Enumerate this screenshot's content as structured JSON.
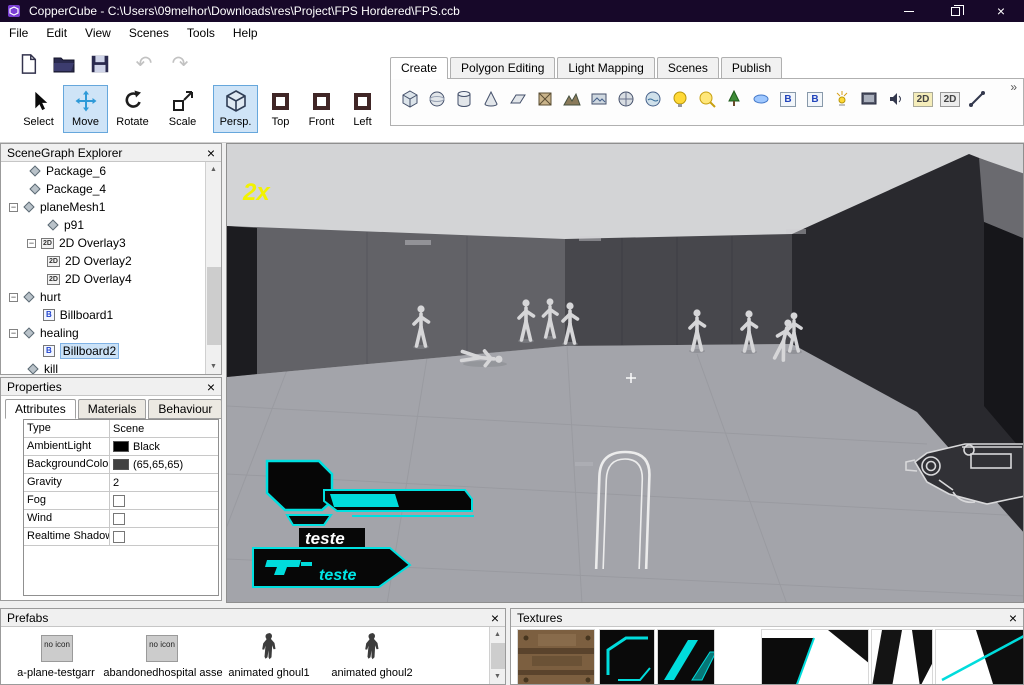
{
  "window": {
    "title": "CopperCube - C:\\Users\\09melhor\\Downloads\\res\\Project\\FPS Hordered\\FPS.ccb"
  },
  "menu": {
    "items": [
      "File",
      "Edit",
      "View",
      "Scenes",
      "Tools",
      "Help"
    ]
  },
  "ribbon": {
    "tabs": [
      "Create",
      "Polygon Editing",
      "Light Mapping",
      "Scenes",
      "Publish"
    ],
    "active_tab": "Create",
    "overflow": "»"
  },
  "tools": {
    "labels": [
      "Select",
      "Move",
      "Rotate",
      "Scale",
      "Persp.",
      "Top",
      "Front",
      "Left"
    ],
    "selected": [
      "Move",
      "Persp."
    ]
  },
  "icons": {
    "close": "×",
    "collapse": "−",
    "undo": "↶",
    "redo": "↷",
    "badge_b": "B",
    "badge_2d": "2D",
    "scroll_up": "▲",
    "scroll_down": "▼"
  },
  "scenegraph": {
    "title": "SceneGraph Explorer",
    "items": [
      "Package_6",
      "Package_4",
      "planeMesh1",
      "p91",
      "2D Overlay3",
      "2D Overlay2",
      "2D Overlay4",
      "hurt",
      "Billboard1",
      "healing",
      "Billboard2",
      "kill"
    ],
    "selected_item": "Billboard2"
  },
  "properties": {
    "title": "Properties",
    "tabs": [
      "Attributes",
      "Materials",
      "Behaviour"
    ],
    "active_tab": "Attributes",
    "rows": [
      {
        "name": "Type",
        "value": "Scene"
      },
      {
        "name": "AmbientLight",
        "value": "Black",
        "swatch": "#000000"
      },
      {
        "name": "BackgroundColor",
        "value": "(65,65,65)",
        "swatch": "#414141"
      },
      {
        "name": "Gravity",
        "value": "2"
      },
      {
        "name": "Fog",
        "value": ""
      },
      {
        "name": "Wind",
        "value": ""
      },
      {
        "name": "Realtime Shadow",
        "value": ""
      }
    ]
  },
  "viewport": {
    "speed_indicator": "2x",
    "hud_label_1": "teste",
    "hud_label_2": "teste"
  },
  "prefabs": {
    "title": "Prefabs",
    "no_icon_label": "no icon",
    "items": [
      "a-plane-testgarr",
      "abandonedhospital asse",
      "animated ghoul1",
      "animated ghoul2"
    ]
  },
  "textures": {
    "title": "Textures"
  },
  "colors": {
    "accent_cyan": "#00e0e0",
    "selection_blue": "#cfe4f7",
    "titlebar": "#170829",
    "viewport_floor": "#a3a4aa"
  }
}
